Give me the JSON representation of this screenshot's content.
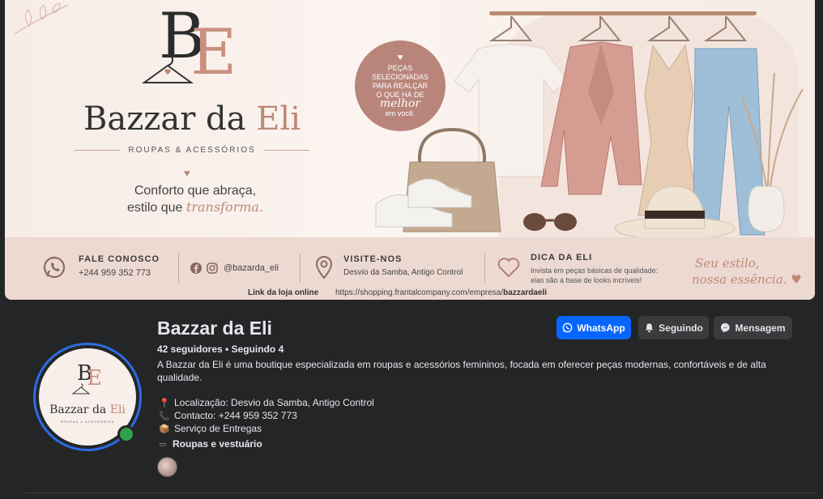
{
  "cover": {
    "logo_initials_b": "B",
    "logo_initials_e": "E",
    "brand_name_a": "Bazzar da ",
    "brand_name_b": "Eli",
    "brand_sub": "ROUPAS & ACESSÓRIOS",
    "tagline_1": "Conforto que abraça,",
    "tagline_2a": "estilo que ",
    "tagline_2b": "transforma.",
    "badge_l1": "PEÇAS",
    "badge_l2": "SELECIONADAS",
    "badge_l3": "PARA REALÇAR",
    "badge_l4": "O QUE HÁ DE",
    "badge_l5": "melhor",
    "badge_l6": "em você.",
    "contact_head": "FALE CONOSCO",
    "contact_phone": "+244 959 352 773",
    "social_handle": "@bazarda_eli",
    "visit_head": "VISITE-NOS",
    "visit_addr": "Desvio da Samba, Antigo Control",
    "tip_head": "DICA DA ELI",
    "tip_l1": "Invista em peças básicas de qualidade:",
    "tip_l2": "elas são a base de looks incríveis!",
    "script_l1": "Seu estilo,",
    "script_l2": "nossa essência.",
    "link_label": "Link da loja online",
    "link_url_a": "https://shopping.frantalcompany.com/empresa/",
    "link_url_b": "bazzardaeli"
  },
  "avatar": {
    "be_b": "B",
    "be_e": "E",
    "title_a": "Bazzar da ",
    "title_b": "Eli",
    "sub": "ROUPAS & ACESSÓRIOS"
  },
  "profile": {
    "name": "Bazzar da Eli",
    "stats": "42 seguidores • Seguindo 4",
    "bio": "A Bazzar da Eli é uma boutique especializada em roupas e acessórios femininos, focada em oferecer peças modernas, confortáveis e de alta qualidade.",
    "location": "Localização: Desvio da Samba, Antigo Control",
    "contact": "Contacto: +244 959 352 773",
    "delivery": "Serviço de Entregas",
    "category": "Roupas e vestuário"
  },
  "actions": {
    "whatsapp": "WhatsApp",
    "following": "Seguindo",
    "message": "Mensagem"
  },
  "icons": [
    "pin-icon",
    "phone-icon",
    "box-icon",
    "category-icon",
    "whatsapp-icon",
    "bell-icon",
    "messenger-icon"
  ],
  "colors": {
    "accent": "#0866ff",
    "brand_rose": "#c08877",
    "online": "#31a24c",
    "background": "#242526"
  }
}
